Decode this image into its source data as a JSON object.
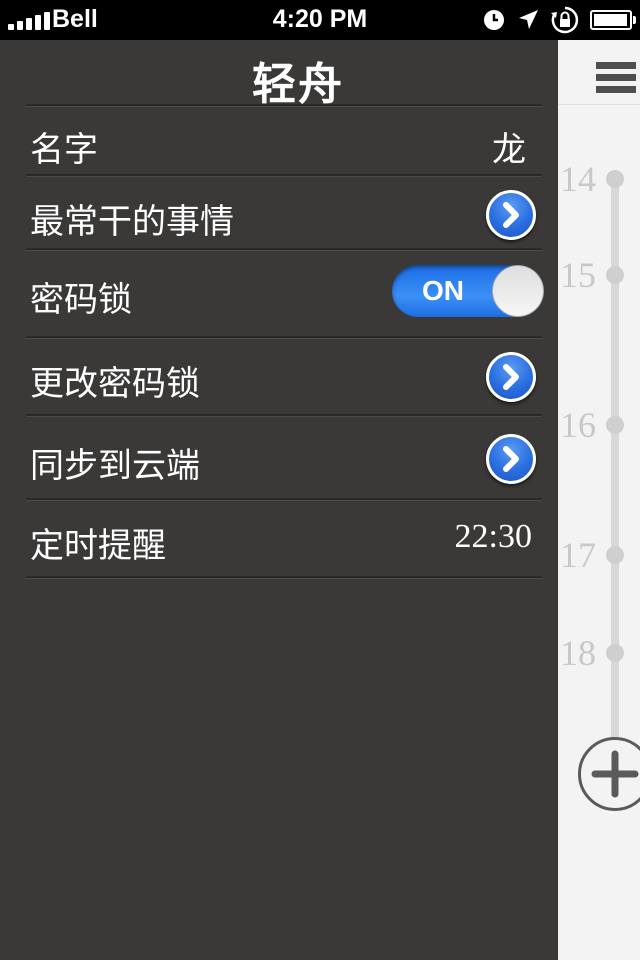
{
  "status_bar": {
    "carrier": "Bell",
    "time": "4:20 PM",
    "icons": [
      "signal-bars-icon",
      "alarm-clock-icon",
      "location-arrow-icon",
      "rotation-lock-icon",
      "battery-icon"
    ]
  },
  "settings": {
    "title": "轻舟",
    "rows": [
      {
        "label": "名字",
        "value": "龙"
      },
      {
        "label": "最常干的事情",
        "accessory": "chevron-right-icon"
      },
      {
        "label": "密码锁",
        "toggle": "ON",
        "toggle_on": true
      },
      {
        "label": "更改密码锁",
        "accessory": "chevron-right-icon"
      },
      {
        "label": "同步到云端",
        "accessory": "chevron-right-icon"
      },
      {
        "label": "定时提醒",
        "value": "22:30"
      }
    ]
  },
  "timeline": {
    "menu_icon": "hamburger-menu-icon",
    "ticks": [
      "14",
      "15",
      "16",
      "17",
      "18"
    ],
    "add_icon": "plus-circle-icon"
  },
  "colors": {
    "panel_background": "#3a3938",
    "timeline_background": "#f3f3f3",
    "toggle_blue": "#2a7ef0",
    "disclosure_blue": "#2a6ee0"
  }
}
